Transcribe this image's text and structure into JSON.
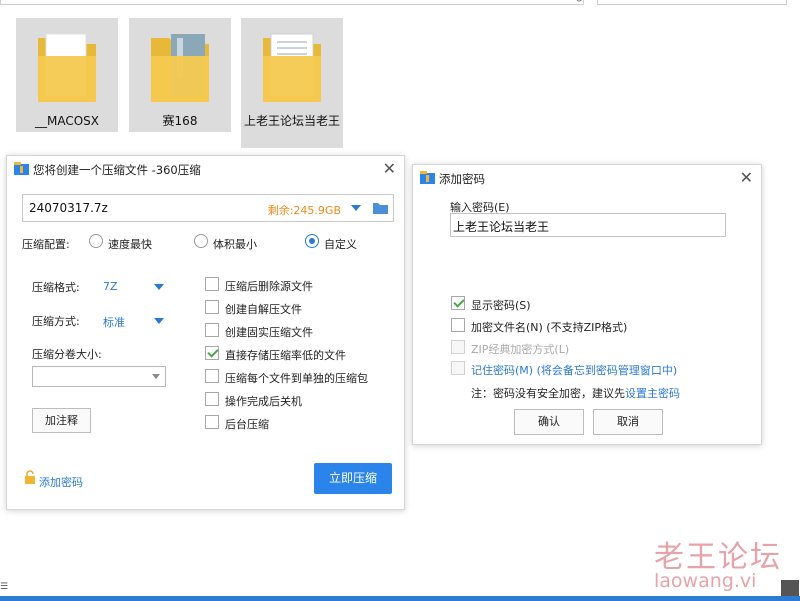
{
  "explorer": {
    "folders": [
      {
        "name": "__MACOSX"
      },
      {
        "name": "赛168"
      },
      {
        "name": "上老王论坛当老王"
      }
    ]
  },
  "compress_dialog": {
    "title": "您将创建一个压缩文件 -360压缩",
    "filename": "24070317.7z",
    "free_space": "剩余:245.9GB",
    "config_label": "压缩配置:",
    "options": [
      "速度最快",
      "体积最小",
      "自定义"
    ],
    "selected_option": "自定义",
    "format_label": "压缩格式:",
    "format_value": "7Z",
    "method_label": "压缩方式:",
    "method_value": "标准",
    "volume_label": "压缩分卷大小:",
    "volume_value": "",
    "comment_button": "加注释",
    "checkboxes": [
      {
        "label": "压缩后删除源文件",
        "checked": false
      },
      {
        "label": "创建自解压文件",
        "checked": false
      },
      {
        "label": "创建固实压缩文件",
        "checked": false
      },
      {
        "label": "直接存储压缩率低的文件",
        "checked": true
      },
      {
        "label": "压缩每个文件到单独的压缩包",
        "checked": false
      },
      {
        "label": "操作完成后关机",
        "checked": false
      },
      {
        "label": "后台压缩",
        "checked": false
      }
    ],
    "add_password_link": "添加密码",
    "compress_button": "立即压缩"
  },
  "password_dialog": {
    "title": "添加密码",
    "input_label": "输入密码(E)",
    "password_value": "上老王论坛当老王",
    "checkboxes": [
      {
        "label": "显示密码(S)",
        "checked": true,
        "disabled": false,
        "link": false
      },
      {
        "label": "加密文件名(N) (不支持ZIP格式)",
        "checked": false,
        "disabled": false,
        "link": false
      },
      {
        "label": "ZIP经典加密方式(L)",
        "checked": false,
        "disabled": true,
        "link": false
      },
      {
        "label": "记住密码(M) (将会备忘到密码管理窗口中)",
        "checked": false,
        "disabled": true,
        "link": true
      }
    ],
    "note_prefix": "注：密码没有安全加密，建议先",
    "note_link": "设置主密码",
    "ok_button": "确认",
    "cancel_button": "取消"
  },
  "watermark": {
    "cn": "老王论坛",
    "en": "laowang.vi"
  },
  "colors": {
    "accent": "#2b84ea",
    "link": "#2b79d6",
    "free_space": "#f28a1b",
    "folder": "#f6c94f",
    "watermark": "#e8a3a8"
  }
}
